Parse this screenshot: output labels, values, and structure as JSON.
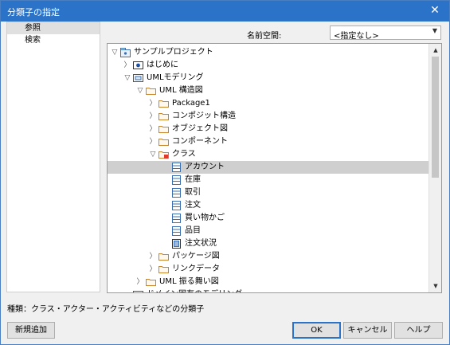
{
  "window": {
    "title": "分類子の指定",
    "close": "✕"
  },
  "left_panel": {
    "items": [
      {
        "label": "参照"
      },
      {
        "label": "検索"
      }
    ]
  },
  "namespace": {
    "label": "名前空間:",
    "value": "<指定なし>"
  },
  "tree": {
    "nodes": [
      {
        "label": "サンプルプロジェクト",
        "exp": "▽",
        "icon": "project"
      },
      {
        "label": "はじめに",
        "exp": "〉",
        "icon": "view"
      },
      {
        "label": "UMLモデリング",
        "exp": "▽",
        "icon": "view2"
      },
      {
        "label": "UML 構造図",
        "exp": "▽",
        "icon": "folder"
      },
      {
        "label": "Package1",
        "exp": "〉",
        "icon": "folder"
      },
      {
        "label": "コンポジット構造",
        "exp": "〉",
        "icon": "folder"
      },
      {
        "label": "オブジェクト図",
        "exp": "〉",
        "icon": "folder"
      },
      {
        "label": "コンポーネント",
        "exp": "〉",
        "icon": "folder"
      },
      {
        "label": "クラス",
        "exp": "▽",
        "icon": "folder-diagram"
      },
      {
        "label": "アカウント",
        "exp": "",
        "icon": "class"
      },
      {
        "label": "在庫",
        "exp": "",
        "icon": "class"
      },
      {
        "label": "取引",
        "exp": "",
        "icon": "class"
      },
      {
        "label": "注文",
        "exp": "",
        "icon": "class"
      },
      {
        "label": "買い物かご",
        "exp": "",
        "icon": "class"
      },
      {
        "label": "品目",
        "exp": "",
        "icon": "class"
      },
      {
        "label": "注文状況",
        "exp": "",
        "icon": "class-alt"
      },
      {
        "label": "パッケージ図",
        "exp": "〉",
        "icon": "folder"
      },
      {
        "label": "リンクデータ",
        "exp": "〉",
        "icon": "folder"
      },
      {
        "label": "UML 振る舞い図",
        "exp": "〉",
        "icon": "folder"
      },
      {
        "label": "ドメイン固有のモデリング",
        "exp": "",
        "icon": "view2"
      }
    ]
  },
  "hint": "種類：クラス・アクター・アクティビティなどの分類子",
  "buttons": {
    "new": "新規追加",
    "ok": "OK",
    "cancel": "キャンセル",
    "help": "ヘルプ"
  },
  "colors": {
    "titlebar": "#2b73c9",
    "selection": "#cfcfcf",
    "folder": "#c8852a",
    "class_icon": "#3a6fb0"
  }
}
